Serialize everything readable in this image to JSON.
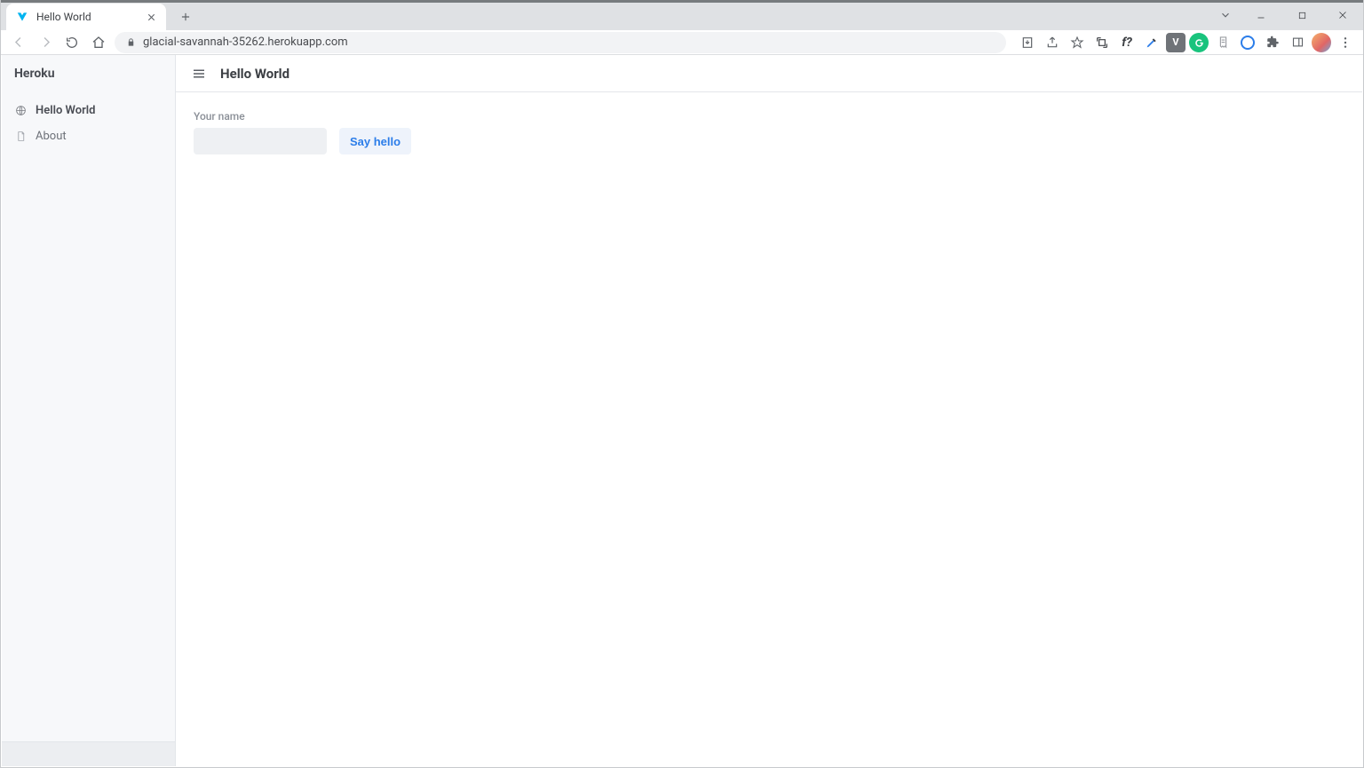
{
  "browser": {
    "tab": {
      "title": "Hello World"
    },
    "url": "glacial-savannah-35262.herokuapp.com",
    "extensions": {
      "v_label": "V",
      "fx_label": "f?"
    }
  },
  "sidebar": {
    "title": "Heroku",
    "items": [
      {
        "label": "Hello World",
        "icon": "globe-icon",
        "active": true
      },
      {
        "label": "About",
        "icon": "document-icon",
        "active": false
      }
    ]
  },
  "header": {
    "title": "Hello World"
  },
  "form": {
    "name_label": "Your name",
    "name_value": "",
    "submit_label": "Say hello"
  }
}
